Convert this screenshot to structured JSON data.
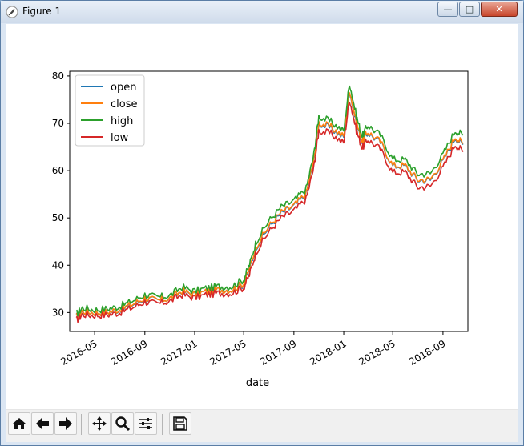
{
  "window": {
    "title": "Figure 1"
  },
  "toolbar": {
    "buttons": [
      "home-icon",
      "back-arrow-icon",
      "forward-arrow-icon",
      "pan-icon",
      "zoom-icon",
      "subplots-icon",
      "save-icon"
    ]
  },
  "chart_data": {
    "type": "line",
    "title": "",
    "xlabel": "date",
    "ylabel": "",
    "xlim": [
      "2016-03-01",
      "2018-11-01"
    ],
    "ylim": [
      26,
      81
    ],
    "x_tick_labels": [
      "2016-05",
      "2016-09",
      "2017-01",
      "2017-05",
      "2017-09",
      "2018-01",
      "2018-05",
      "2018-09"
    ],
    "y_tick_labels": [
      "30",
      "40",
      "50",
      "60",
      "70",
      "80"
    ],
    "y_ticks": [
      30,
      40,
      50,
      60,
      70,
      80
    ],
    "legend": {
      "placement": "upper-left",
      "entries": [
        "open",
        "close",
        "high",
        "low"
      ]
    },
    "colors": {
      "open": "#1f77b4",
      "close": "#ff7f0e",
      "high": "#2ca02c",
      "low": "#d62728"
    },
    "x": [
      "2016-03-17",
      "2016-04-01",
      "2016-05-01",
      "2016-06-01",
      "2016-07-01",
      "2016-08-01",
      "2016-09-01",
      "2016-10-01",
      "2016-11-01",
      "2016-12-01",
      "2017-01-01",
      "2017-02-01",
      "2017-03-01",
      "2017-04-01",
      "2017-05-01",
      "2017-05-15",
      "2017-06-01",
      "2017-07-01",
      "2017-08-01",
      "2017-09-01",
      "2017-10-01",
      "2017-10-20",
      "2017-11-01",
      "2017-12-01",
      "2018-01-01",
      "2018-01-15",
      "2018-02-01",
      "2018-02-15",
      "2018-03-01",
      "2018-04-01",
      "2018-05-01",
      "2018-06-01",
      "2018-07-01",
      "2018-08-01",
      "2018-09-01",
      "2018-10-01",
      "2018-10-20"
    ],
    "series": [
      {
        "name": "open",
        "values": [
          29.0,
          30.2,
          30.0,
          30.1,
          30.6,
          31.6,
          33.0,
          32.5,
          33.0,
          34.5,
          33.8,
          34.5,
          34.8,
          34.8,
          36.0,
          39.0,
          44.0,
          48.0,
          51.0,
          52.5,
          55.0,
          62.0,
          70.0,
          69.0,
          67.0,
          77.0,
          70.0,
          66.0,
          68.0,
          66.0,
          61.0,
          61.0,
          58.0,
          58.0,
          62.0,
          67.0,
          65.5
        ]
      },
      {
        "name": "close",
        "values": [
          29.0,
          30.3,
          30.0,
          30.1,
          30.7,
          31.7,
          33.1,
          32.5,
          33.0,
          34.6,
          33.8,
          34.5,
          34.8,
          34.8,
          36.2,
          39.2,
          44.2,
          48.2,
          51.2,
          52.6,
          55.2,
          62.3,
          70.2,
          69.2,
          67.2,
          77.2,
          70.2,
          66.2,
          68.2,
          66.1,
          61.1,
          61.1,
          58.1,
          58.2,
          62.1,
          67.2,
          65.7
        ]
      },
      {
        "name": "high",
        "values": [
          29.6,
          31.0,
          30.6,
          30.8,
          31.3,
          32.4,
          33.8,
          33.2,
          33.6,
          35.4,
          34.5,
          35.2,
          35.5,
          35.5,
          37.0,
          40.0,
          45.2,
          49.3,
          52.3,
          53.6,
          56.2,
          63.5,
          71.5,
          70.3,
          68.3,
          78.6,
          71.5,
          67.3,
          69.6,
          67.5,
          62.4,
          62.3,
          59.3,
          59.4,
          63.4,
          68.5,
          67.5
        ]
      },
      {
        "name": "low",
        "values": [
          28.3,
          29.6,
          29.4,
          29.5,
          30.0,
          31.0,
          32.3,
          31.8,
          32.4,
          33.8,
          33.1,
          33.8,
          34.1,
          34.1,
          35.3,
          38.0,
          43.0,
          47.0,
          50.0,
          51.5,
          54.0,
          60.8,
          68.5,
          67.8,
          65.8,
          75.2,
          68.5,
          64.8,
          66.6,
          64.5,
          59.6,
          59.7,
          56.5,
          56.7,
          60.6,
          65.6,
          64.0
        ]
      }
    ]
  }
}
